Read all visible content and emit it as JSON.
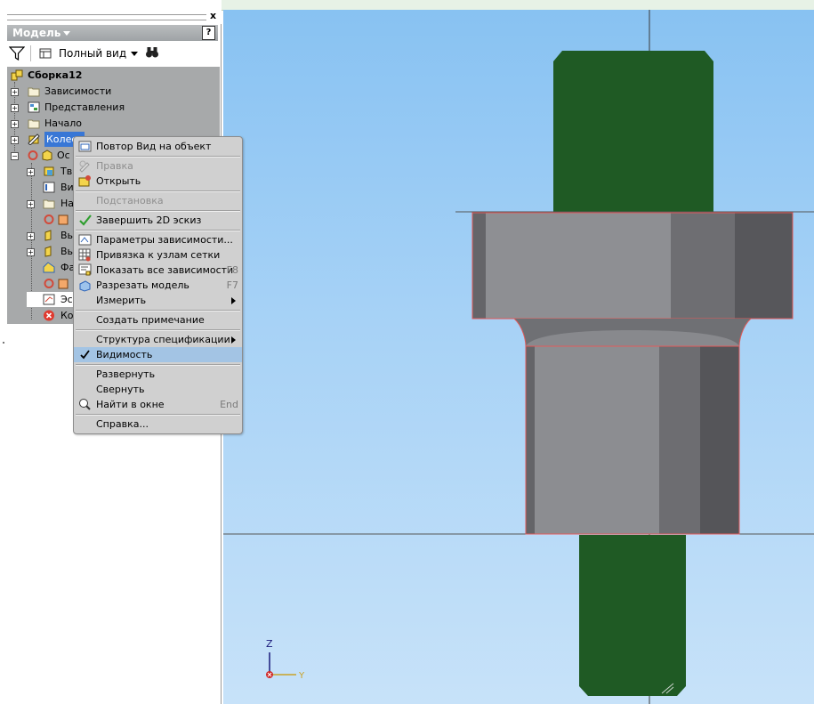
{
  "panel": {
    "close_glyph": "x",
    "header_title": "Модель",
    "help_glyph": "?",
    "view_label": "Полный вид"
  },
  "tree": {
    "root": "Сборка12",
    "items": [
      {
        "label": "Зависимости"
      },
      {
        "label": "Представления"
      },
      {
        "label": "Начало"
      },
      {
        "label": "Колесо"
      },
      {
        "label": "Ос"
      }
    ],
    "children": [
      {
        "label": "Тв"
      },
      {
        "label": "Ви"
      },
      {
        "label": "На"
      },
      {
        "label": "Вы"
      },
      {
        "label": "Вы"
      },
      {
        "label": "Фа"
      },
      {
        "label": ""
      },
      {
        "label": "Эс"
      },
      {
        "label": "Ко"
      }
    ]
  },
  "context_menu": {
    "items": [
      {
        "label": "Повтор Вид на объект",
        "icon": "zoom-icon"
      },
      {
        "label": "Правка",
        "icon": "edit-icon",
        "disabled": true
      },
      {
        "label": "Открыть",
        "icon": "open-icon"
      },
      {
        "label": "Подстановка",
        "disabled": true
      },
      {
        "label": "Завершить 2D эскиз",
        "icon": "check-icon"
      },
      {
        "label": "Параметры зависимости...",
        "icon": "constraint-icon"
      },
      {
        "label": "Привязка к узлам сетки",
        "icon": "grid-icon"
      },
      {
        "label": "Показать все зависимости",
        "shortcut": "F8",
        "icon": "show-constraints-icon"
      },
      {
        "label": "Разрезать модель",
        "shortcut": "F7",
        "icon": "slice-icon"
      },
      {
        "label": "Измерить",
        "submenu": true
      },
      {
        "label": "Создать примечание"
      },
      {
        "label": "Структура спецификации",
        "submenu": true
      },
      {
        "label": "Видимость",
        "checked": true
      },
      {
        "label": "Развернуть"
      },
      {
        "label": "Свернуть"
      },
      {
        "label": "Найти в окне",
        "shortcut": "End",
        "icon": "find-icon"
      },
      {
        "label": "Справка..."
      }
    ]
  },
  "viewport": {
    "triad": {
      "z": "Z",
      "y": "Y"
    }
  },
  "colors": {
    "sketch_green": "#1f5a24",
    "part_gray": "#7f7f83",
    "outline_red": "#e25a5a"
  }
}
